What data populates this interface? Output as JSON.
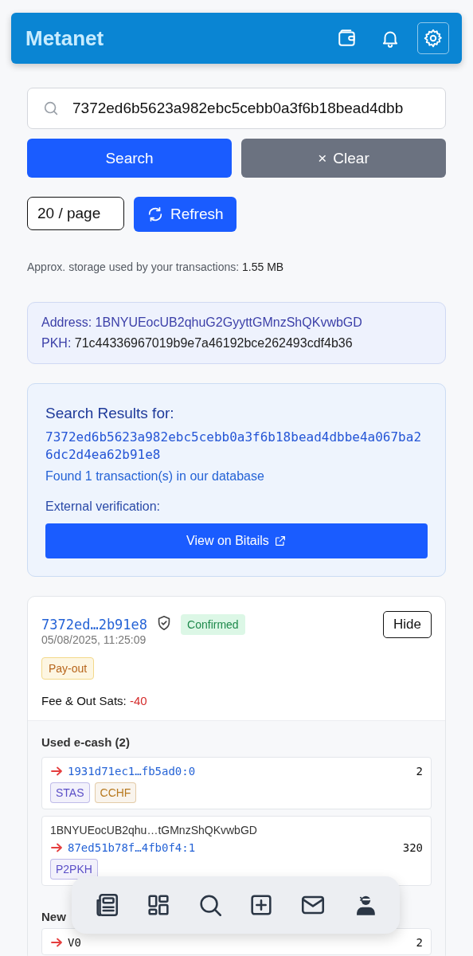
{
  "header": {
    "title": "Metanet",
    "icons": [
      {
        "kind": "wallet",
        "selected": false
      },
      {
        "kind": "bell",
        "selected": false
      },
      {
        "kind": "gear",
        "selected": true
      }
    ]
  },
  "search": {
    "value": "7372ed6b5623a982ebc5cebb0a3f6b18bead4dbb",
    "search_button": "Search",
    "clear_button": "Clear",
    "clear_icon": "×"
  },
  "page_size": "20 / page",
  "refresh_button": "Refresh",
  "storage": {
    "label": "Approx. storage used by your transactions:",
    "value": "1.55 MB"
  },
  "identity": {
    "address_label": "Address:",
    "address": "1BNYUEocUB2qhuG2GyyttGMnzShQKvwbGD",
    "pkh_label": "PKH:",
    "pkh": "71c44336967019b9e7a46192bce262493cdf4b36"
  },
  "results": {
    "title": "Search Results for:",
    "query": "7372ed6b5623a982ebc5cebb0a3f6b18bead4dbbe4a067ba26dc2d4ea62b91e8",
    "found": "Found 1 transaction(s) in our database",
    "external_label": "External verification:",
    "view_button": "View on Bitails"
  },
  "transaction": {
    "txid": "7372ed…2b91e8",
    "status": "Confirmed",
    "hide_button": "Hide",
    "date": "05/08/2025, 11:25:09",
    "type": "Pay-out",
    "fee_label": "Fee & Out Sats:",
    "fee_value": "-40",
    "used_title": "Used e-cash (2)",
    "inputs": [
      {
        "outpoint": "1931d71ec1…fb5ad0:0",
        "amount": "2",
        "tags": [
          {
            "label": "STAS",
            "color": "#5b4fc7"
          },
          {
            "label": "CCHF",
            "color": "#b7791f"
          }
        ]
      },
      {
        "address": "1BNYUEocUB2qhu…tGMnzShQKvwbGD",
        "outpoint": "87ed51b78f…4fb0f4:1",
        "amount": "320",
        "tags": [
          {
            "label": "P2PKH",
            "color": "#5b4fc7"
          }
        ]
      }
    ],
    "new_title": "New",
    "outputs": [
      {
        "outpoint": "V0",
        "amount": "2"
      }
    ]
  },
  "bottom_nav": [
    {
      "kind": "news"
    },
    {
      "kind": "grid"
    },
    {
      "kind": "search"
    },
    {
      "kind": "plus"
    },
    {
      "kind": "mail"
    },
    {
      "kind": "user"
    }
  ]
}
